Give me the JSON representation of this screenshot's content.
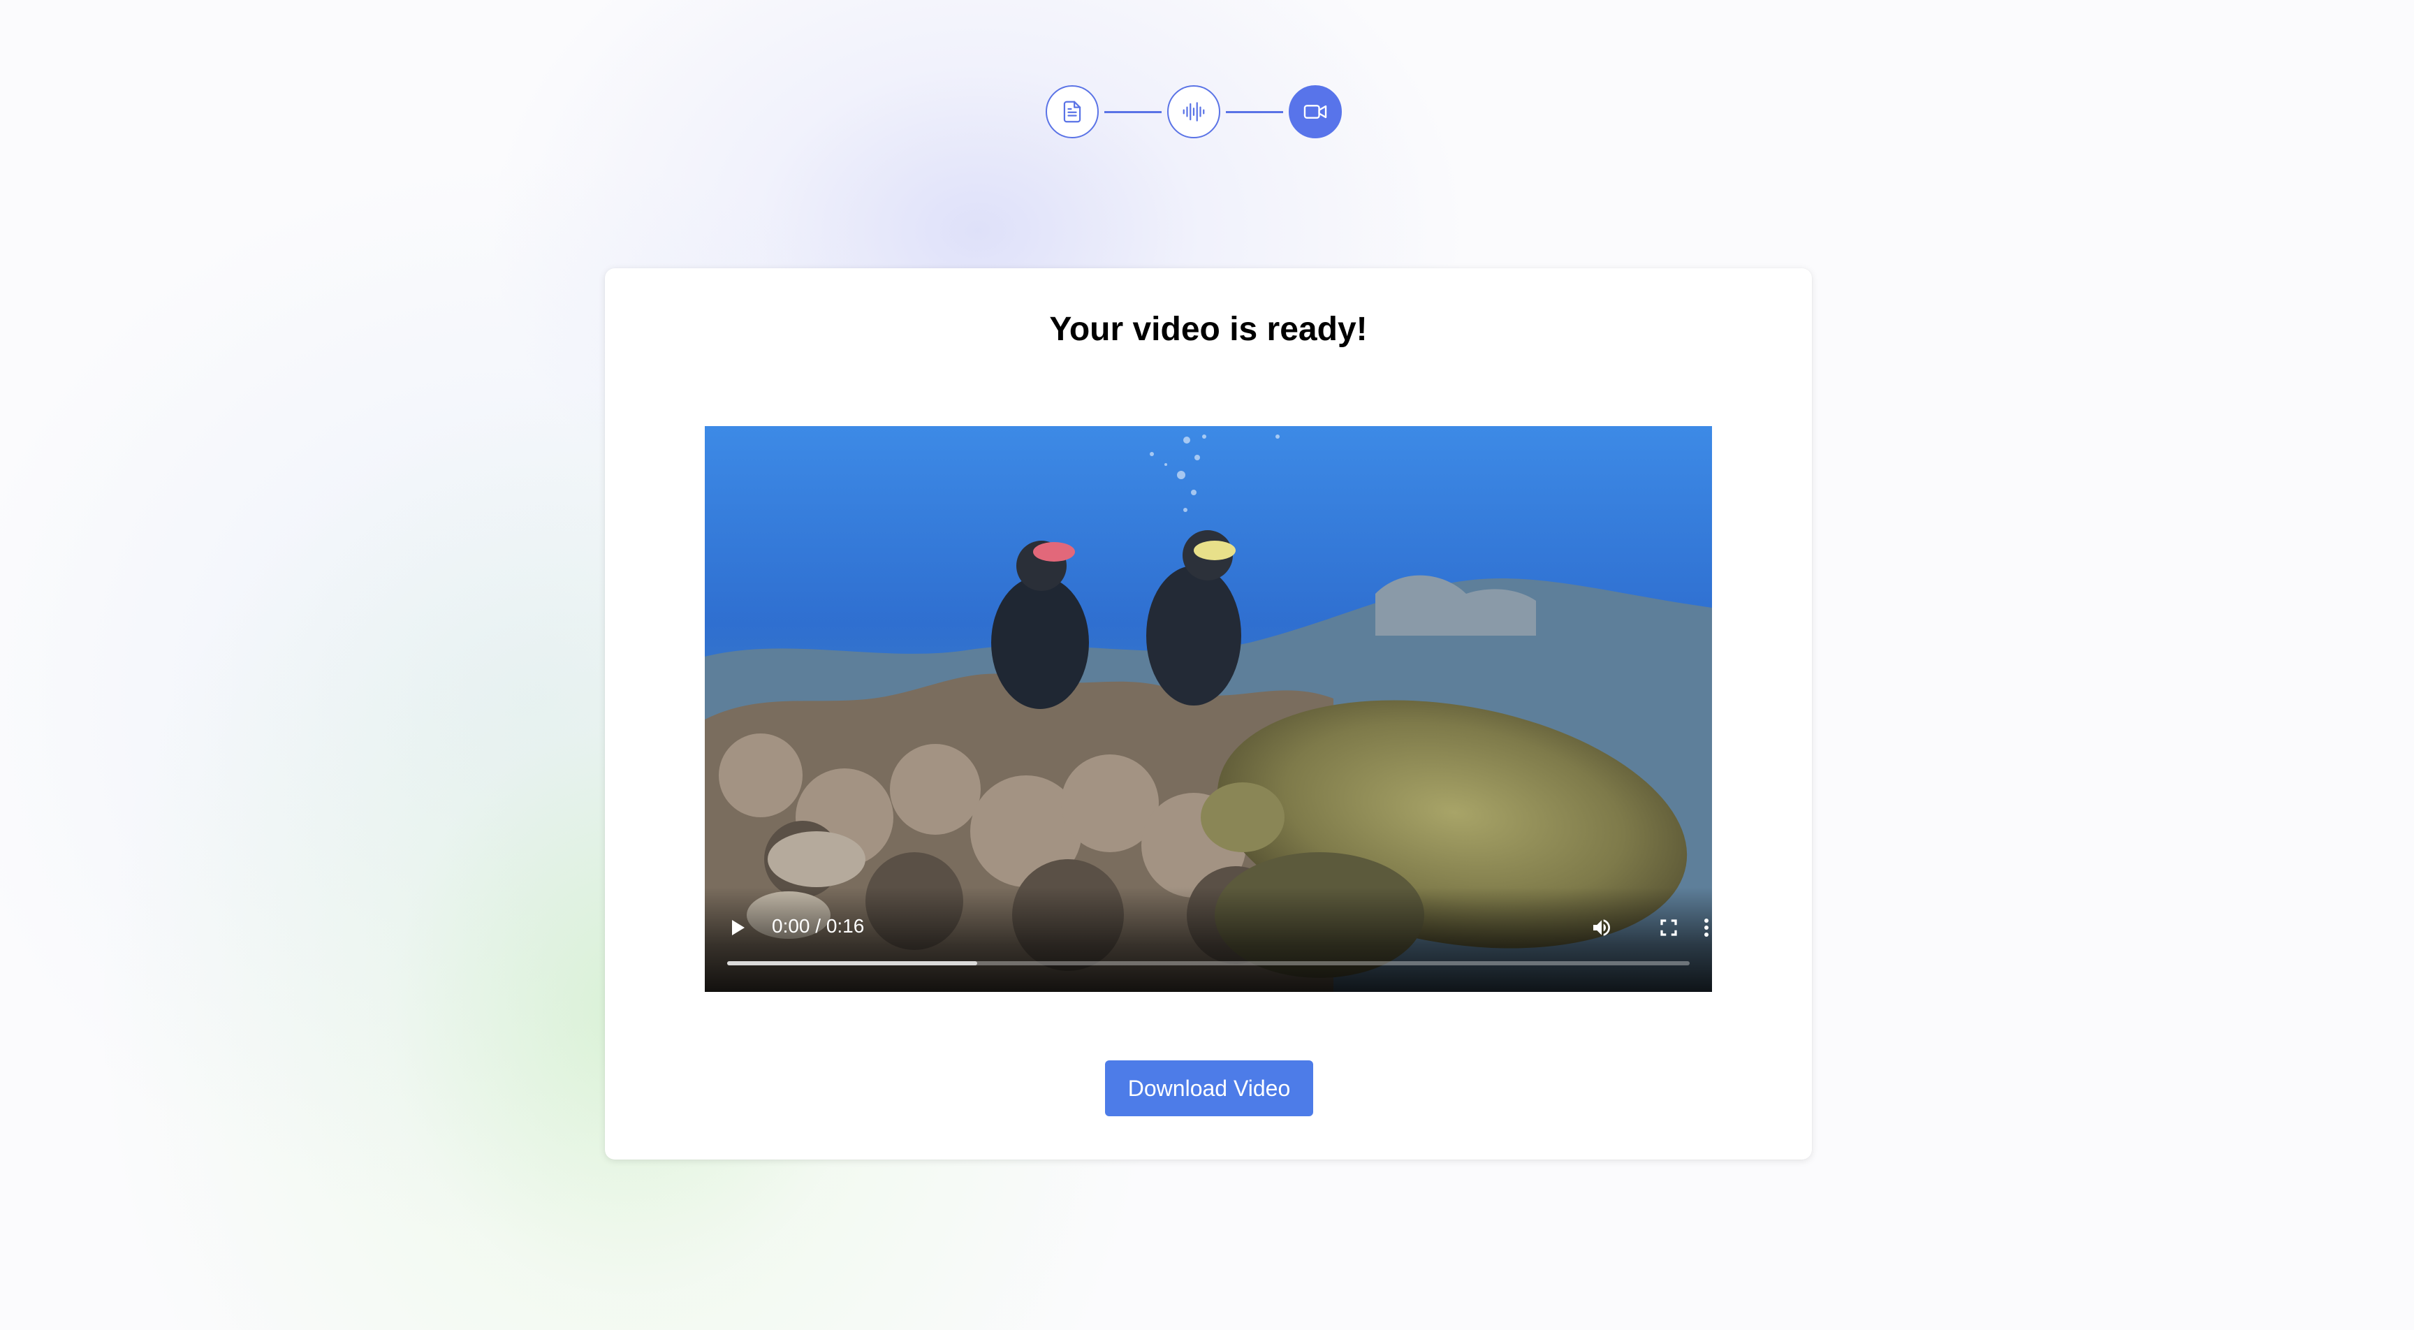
{
  "stepper": {
    "steps": [
      {
        "icon": "document-icon",
        "state": "completed"
      },
      {
        "icon": "audio-waveform-icon",
        "state": "completed"
      },
      {
        "icon": "video-camera-icon",
        "state": "active"
      }
    ],
    "accent_color": "#5874ea"
  },
  "card": {
    "title": "Your video is ready!"
  },
  "video": {
    "time_display": "0:00 / 0:16",
    "buffered_fraction": 0.26,
    "controls": [
      "play-icon",
      "volume-icon",
      "fullscreen-icon",
      "more-options-icon"
    ]
  },
  "download": {
    "label": "Download Video",
    "color": "#4d7ce8"
  }
}
